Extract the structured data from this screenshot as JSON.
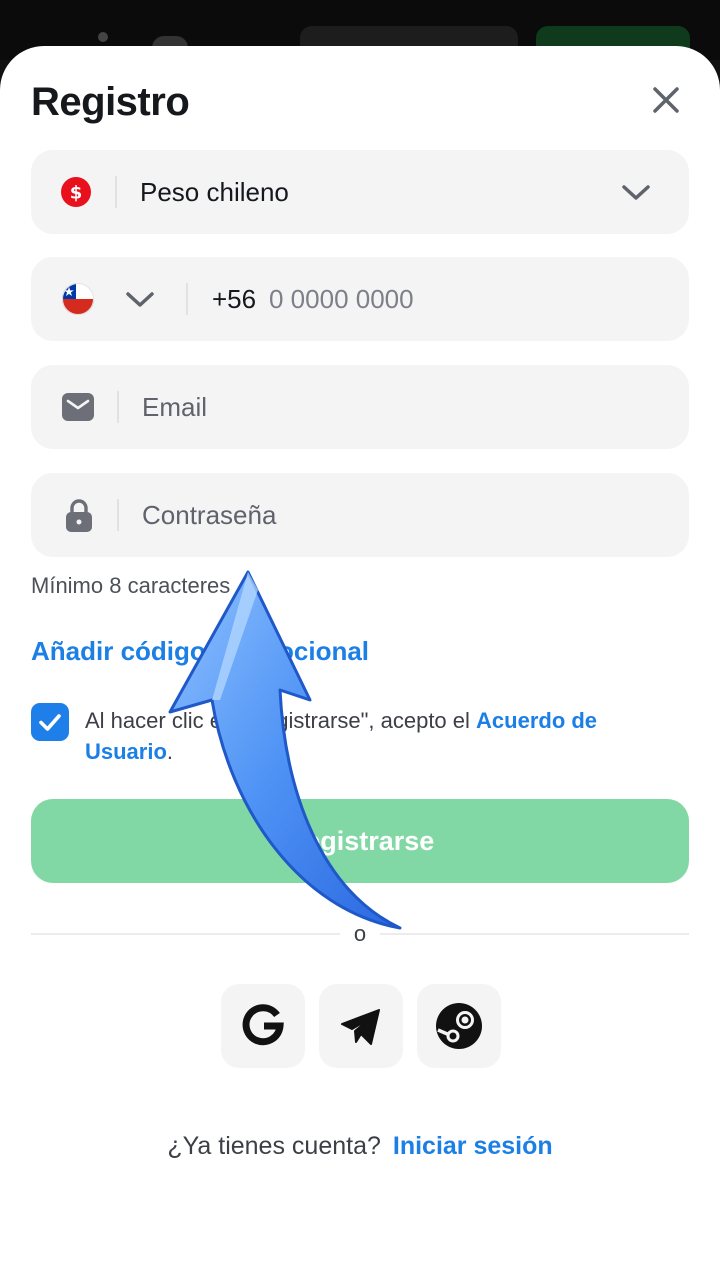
{
  "dialog": {
    "title": "Registro"
  },
  "currency": {
    "icon": "dollar-coin-icon",
    "value": "Peso chileno"
  },
  "phone": {
    "country_flag": "chile-flag-icon",
    "prefix": "+56",
    "placeholder": "0 0000 0000"
  },
  "email": {
    "icon": "envelope-icon",
    "placeholder": "Email"
  },
  "password": {
    "icon": "lock-icon",
    "placeholder": "Contraseña",
    "hint": "Mínimo 8 caracteres"
  },
  "promo": {
    "label": "Añadir código promocional"
  },
  "terms": {
    "checked": true,
    "text": "Al hacer clic en \"Registrarse\", acepto el ",
    "link": "Acuerdo de Usuario",
    "suffix": "."
  },
  "register_button": "Registrarse",
  "divider_text": "o",
  "social": [
    "google-icon",
    "telegram-icon",
    "steam-icon"
  ],
  "login": {
    "question": "¿Ya tienes cuenta?",
    "link": "Iniciar sesión"
  },
  "colors": {
    "accent": "#1e7fe8",
    "register_button": "#82d8a4",
    "field_bg": "#f4f4f5",
    "currency_icon": "#e8101c"
  }
}
